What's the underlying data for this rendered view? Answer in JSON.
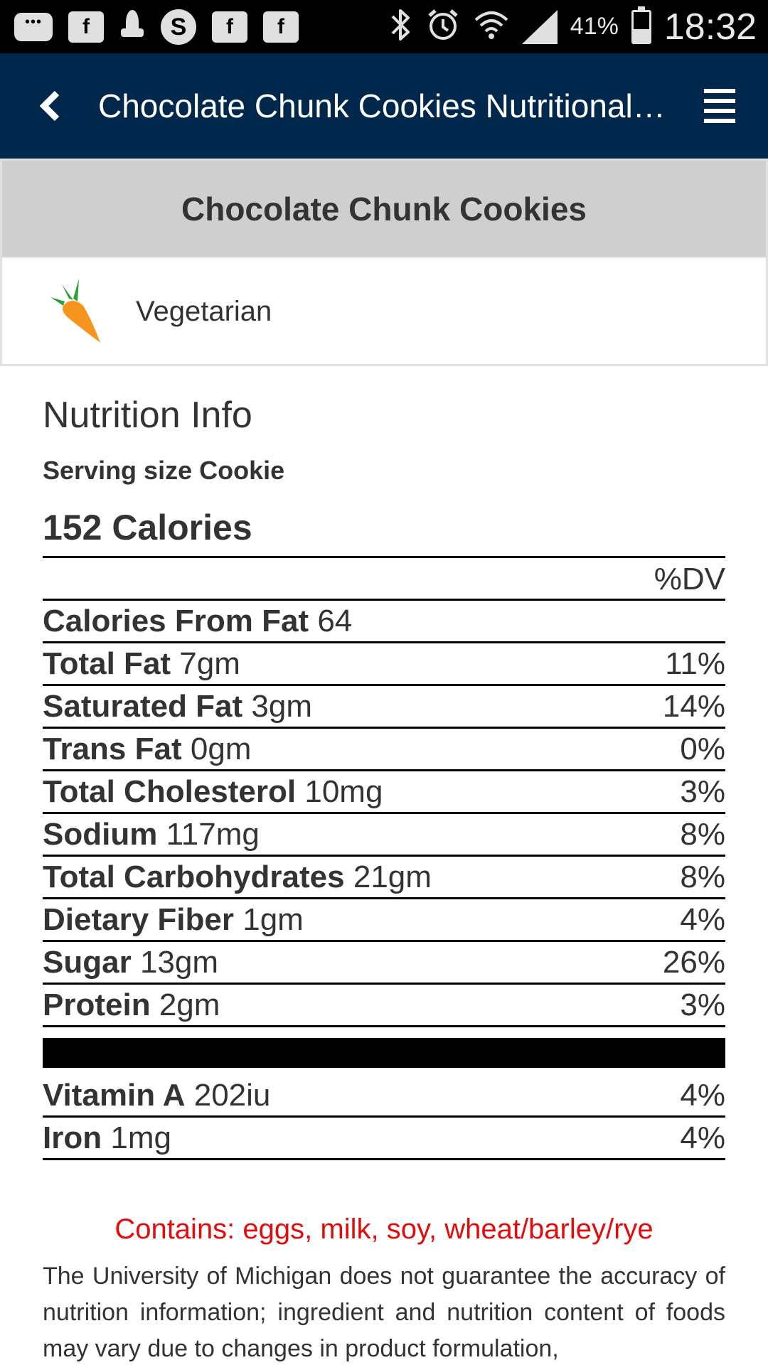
{
  "status_bar": {
    "left_icons": [
      "chat-icon",
      "facebook-icon",
      "rocket-icon",
      "skype-icon",
      "facebook-icon",
      "facebook-icon"
    ],
    "right_icons": [
      "bluetooth-icon",
      "alarm-icon",
      "wifi-icon",
      "signal-icon",
      "battery-icon"
    ],
    "battery_pct": "41%",
    "battery_level": 0.41,
    "time": "18:32",
    "skype_letter": "S",
    "fb_letter": "f"
  },
  "app_bar": {
    "title": "Chocolate Chunk Cookies Nutritional Information",
    "back_icon": "back-chevron-icon",
    "menu_icon": "menu-icon"
  },
  "item": {
    "name": "Chocolate Chunk Cookies",
    "tag": {
      "label": "Vegetarian",
      "icon": "carrot-icon"
    }
  },
  "nutrition": {
    "heading": "Nutrition Info",
    "serving_size": "Serving size Cookie",
    "calories": "152 Calories",
    "dv_header": "%DV",
    "rows": [
      {
        "name": "Calories From Fat",
        "amount": "64",
        "dv": ""
      },
      {
        "name": "Total Fat",
        "amount": "7gm",
        "dv": "11%"
      },
      {
        "name": "Saturated Fat",
        "amount": "3gm",
        "dv": "14%"
      },
      {
        "name": "Trans Fat",
        "amount": "0gm",
        "dv": "0%"
      },
      {
        "name": "Total Cholesterol",
        "amount": "10mg",
        "dv": "3%"
      },
      {
        "name": "Sodium",
        "amount": "117mg",
        "dv": "8%"
      },
      {
        "name": "Total Carbohydrates",
        "amount": "21gm",
        "dv": "8%"
      },
      {
        "name": "Dietary Fiber",
        "amount": "1gm",
        "dv": "4%"
      },
      {
        "name": "Sugar",
        "amount": "13gm",
        "dv": "26%"
      },
      {
        "name": "Protein",
        "amount": "2gm",
        "dv": "3%"
      }
    ],
    "vitamins": [
      {
        "name": "Vitamin A",
        "amount": "202iu",
        "dv": "4%"
      },
      {
        "name": "Iron",
        "amount": "1mg",
        "dv": "4%"
      }
    ],
    "allergens": "Contains: eggs, milk, soy, wheat/barley/rye",
    "disclaimer": "The University of Michigan does not guarantee the accuracy of nutrition information; ingredient and nutrition content of foods may vary due to changes in product formulation,"
  },
  "colors": {
    "app_bar": "#00274c",
    "title_bar": "#cfcfcf",
    "allergen": "#e30c0c",
    "carrot_orange": "#f7941d",
    "carrot_green": "#2e9e3a"
  }
}
